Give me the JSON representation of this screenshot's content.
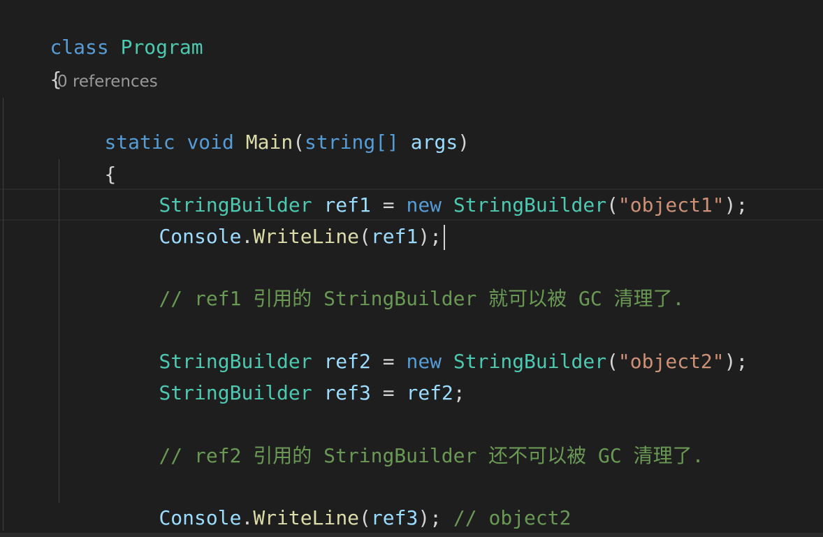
{
  "code": {
    "class_line": {
      "keyword": "class",
      "name": "Program"
    },
    "open_brace_outer": "{",
    "codelens": "0 references",
    "main_line": {
      "static": "static",
      "void": "void",
      "name": "Main",
      "open_paren": "(",
      "param_type": "string[]",
      "param_name": "args",
      "close_paren": ")"
    },
    "open_brace_inner": "{",
    "line_ref1": {
      "type": "StringBuilder",
      "var": "ref1",
      "eq": " = ",
      "new": "new",
      "ctor": "StringBuilder",
      "open": "(",
      "arg": "\"object1\"",
      "close": ");"
    },
    "line_console1": {
      "cls": "Console",
      "dot": ".",
      "method": "WriteLine",
      "open": "(",
      "arg": "ref1",
      "close": ");"
    },
    "comment1": "// ref1 引用的 StringBuilder 就可以被 GC 清理了.",
    "line_ref2": {
      "type": "StringBuilder",
      "var": "ref2",
      "eq": " = ",
      "new": "new",
      "ctor": "StringBuilder",
      "open": "(",
      "arg": "\"object2\"",
      "close": ");"
    },
    "line_ref3": {
      "type": "StringBuilder",
      "var": "ref3",
      "eq": " = ",
      "value": "ref2",
      "close": ";"
    },
    "comment2": "// ref2 引用的 StringBuilder 还不可以被 GC 清理了.",
    "line_console2": {
      "cls": "Console",
      "dot": ".",
      "method": "WriteLine",
      "open": "(",
      "arg": "ref3",
      "close": ");",
      "comment": "// object2"
    },
    "close_brace_inner": "}"
  },
  "colors": {
    "background": "#1e1e1e",
    "keyword": "#569cd6",
    "type": "#4ec9b0",
    "method": "#dcdcaa",
    "variable": "#9cdcfe",
    "string": "#ce9178",
    "comment": "#6a9955",
    "codelens": "#999999"
  }
}
